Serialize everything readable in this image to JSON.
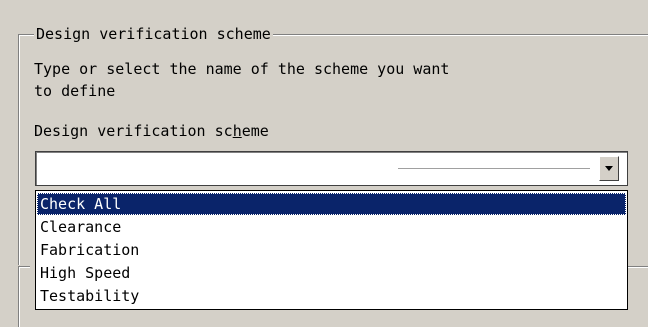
{
  "group": {
    "title": "Design verification scheme"
  },
  "description": "Type or select the name of the scheme you want\nto define",
  "field": {
    "label_before": "Design verification sc",
    "label_mnemonic": "h",
    "label_after": "eme",
    "value": ""
  },
  "dropdown": {
    "items": [
      {
        "label": "Check All",
        "selected": true
      },
      {
        "label": "Clearance",
        "selected": false
      },
      {
        "label": "Fabrication",
        "selected": false
      },
      {
        "label": "High Speed",
        "selected": false
      },
      {
        "label": "Testability",
        "selected": false
      }
    ]
  },
  "colors": {
    "dialog_background": "#d4d0c8",
    "selection_background": "#0a246a",
    "selection_text": "#ffffff"
  },
  "icons": {
    "dropdown_arrow": "chevron-down-icon"
  }
}
